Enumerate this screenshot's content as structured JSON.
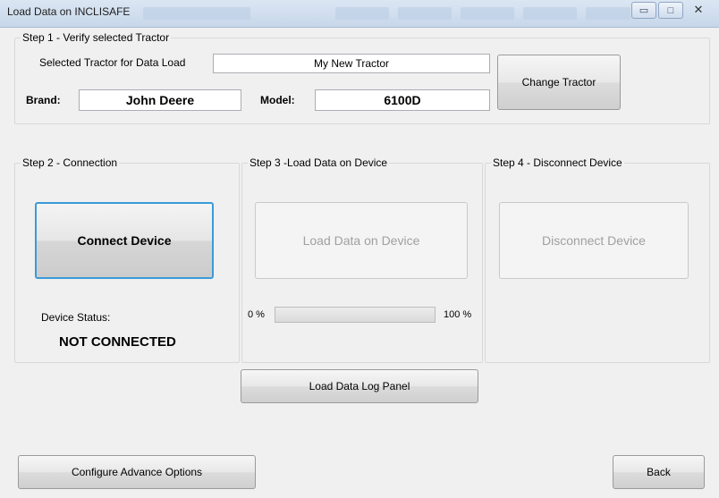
{
  "window": {
    "title": "Load Data on INCLISAFE",
    "controls": [
      "minimize",
      "maximize",
      "close"
    ],
    "close_glyph": "✕"
  },
  "step1": {
    "title": "Step 1 - Verify selected Tractor",
    "selected_label": "Selected Tractor for Data Load",
    "selected_value": "My New Tractor",
    "brand_label": "Brand:",
    "brand_value": "John Deere",
    "model_label": "Model:",
    "model_value": "6100D",
    "change_button": "Change Tractor"
  },
  "step2": {
    "title": "Step 2 - Connection",
    "connect_button": "Connect Device",
    "status_label": "Device Status:",
    "status_value": "NOT CONNECTED"
  },
  "step3": {
    "title": "Step 3 -Load Data on Device",
    "load_button": "Load Data on Device",
    "progress_min": "0 %",
    "progress_max": "100 %",
    "progress_value": 0
  },
  "step4": {
    "title": "Step 4 - Disconnect Device",
    "disconnect_button": "Disconnect Device"
  },
  "footer": {
    "log_panel_button": "Load Data Log Panel",
    "advanced_button": "Configure Advance Options",
    "back_button": "Back"
  }
}
